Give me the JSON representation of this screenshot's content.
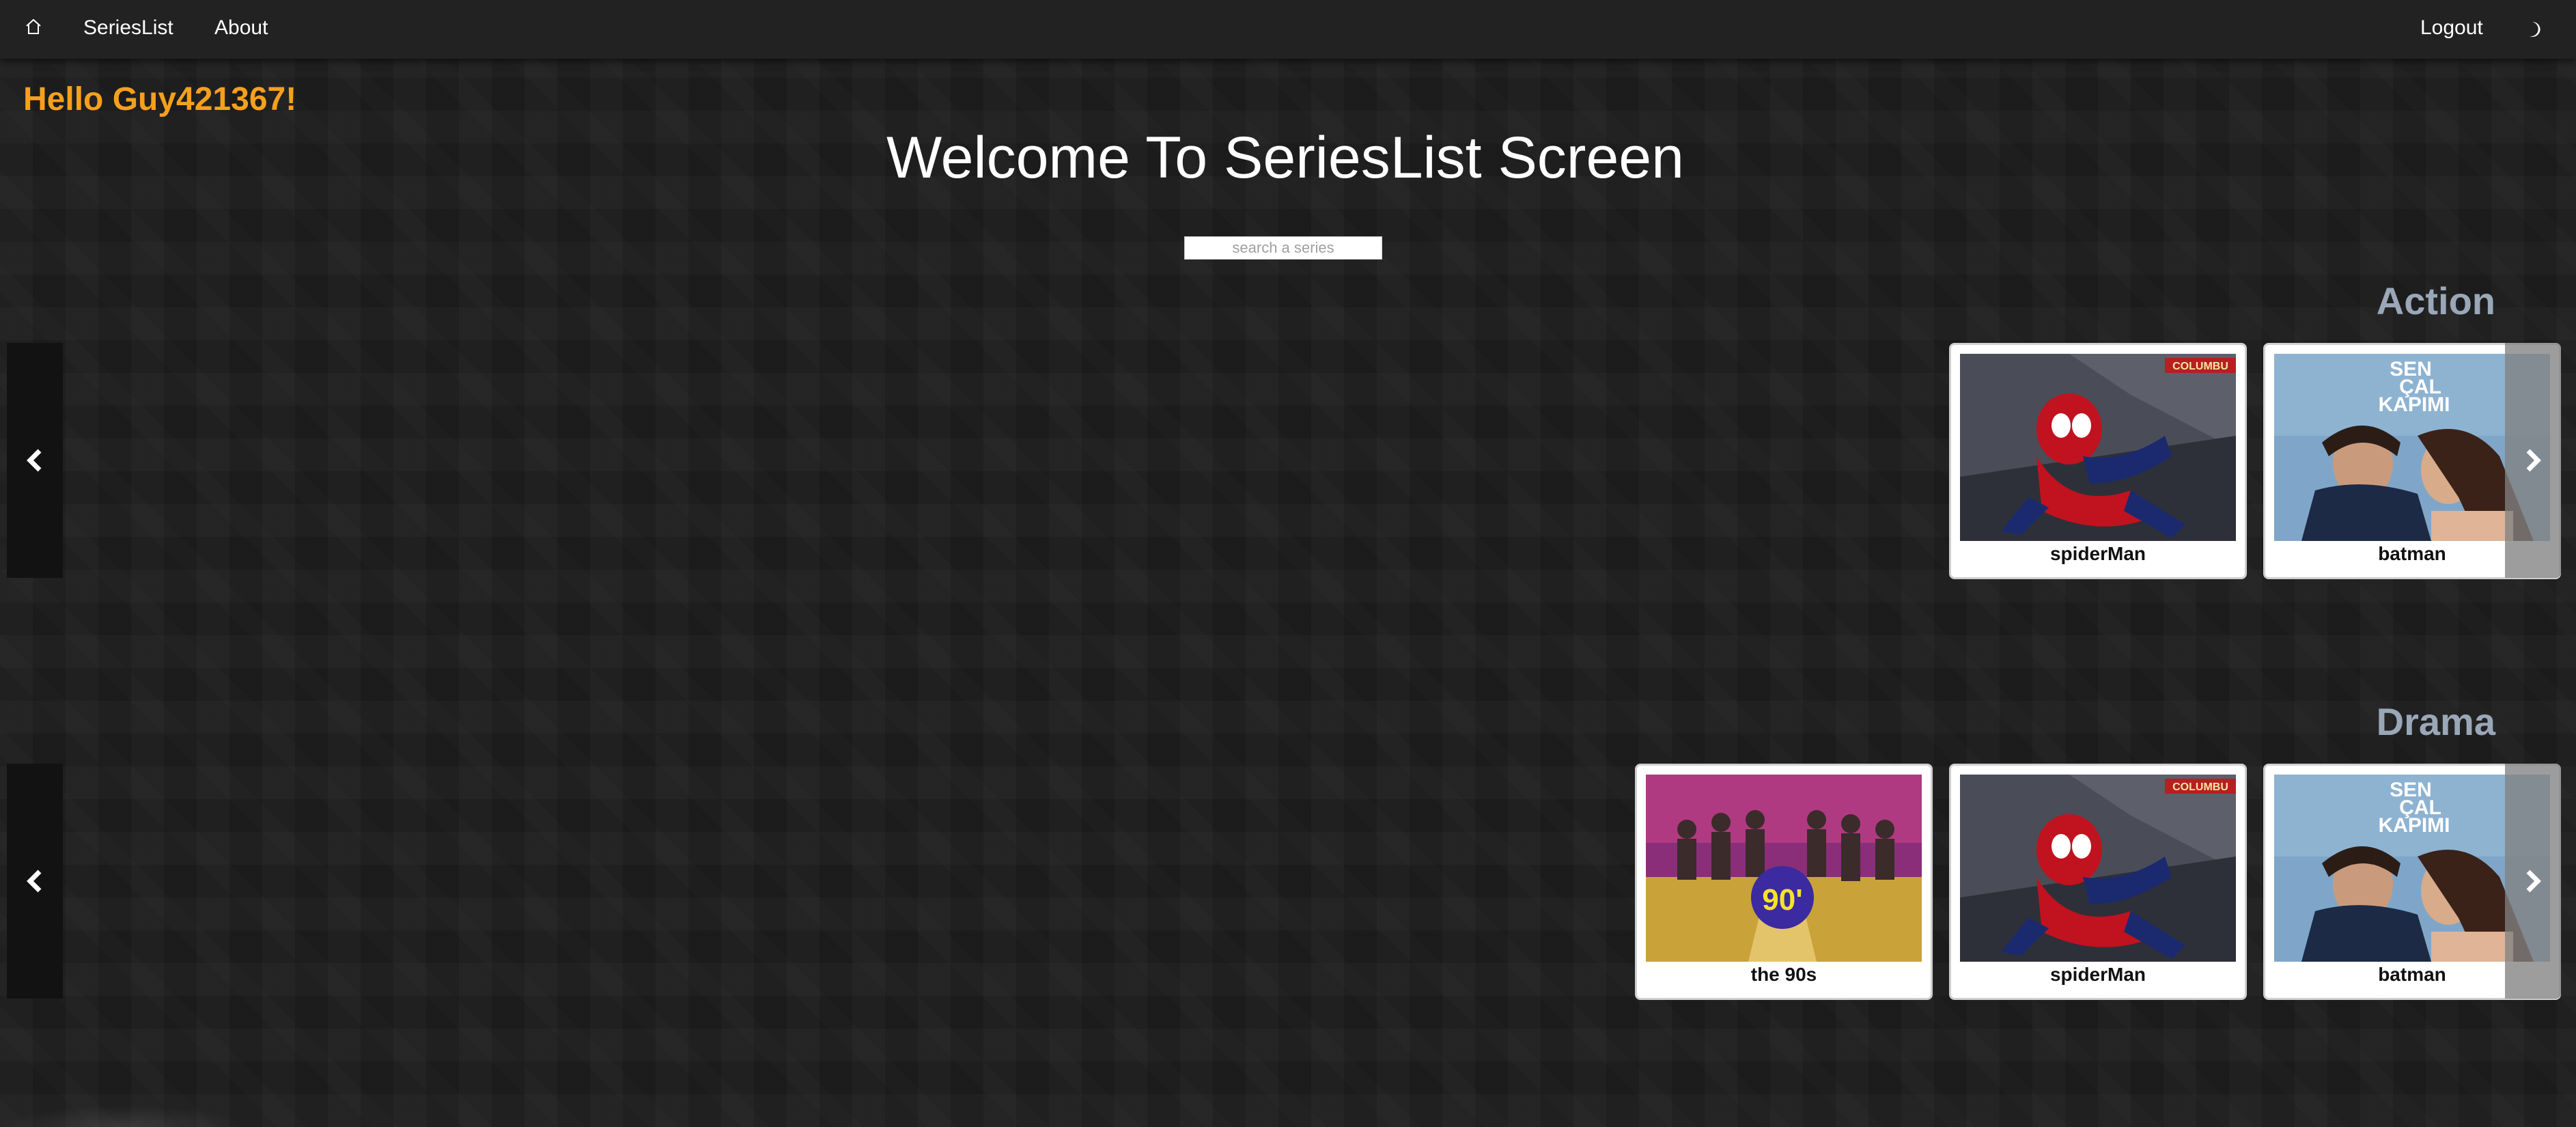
{
  "nav": {
    "home_icon": "home-icon",
    "serieslist_label": "SeriesList",
    "about_label": "About",
    "logout_label": "Logout",
    "theme_icon": "moon-icon"
  },
  "greeting": "Hello Guy421367!",
  "page_title": "Welcome To SeriesList Screen",
  "search": {
    "placeholder": "search a series",
    "value": ""
  },
  "sections": {
    "action": {
      "title": "Action",
      "cards": [
        {
          "name": "spiderMan",
          "poster": "spiderman-poster"
        },
        {
          "name": "batman",
          "poster": "sen-cal-kapimi-poster"
        }
      ]
    },
    "drama": {
      "title": "Drama",
      "cards": [
        {
          "name": "the 90s",
          "poster": "the-90s-poster"
        },
        {
          "name": "spiderMan",
          "poster": "spiderman-poster"
        },
        {
          "name": "batman",
          "poster": "sen-cal-kapimi-poster"
        }
      ]
    }
  },
  "poster_texts": {
    "sen_cal_kapimi_line1": "SEN",
    "sen_cal_kapimi_line2": "ÇAL",
    "sen_cal_kapimi_line3": "KAPIMI",
    "the_90s_logo": "90'"
  },
  "colors": {
    "background": "#1d1d1d",
    "navbar": "#222222",
    "greeting": "#f5a01c",
    "section_title": "#9aa7b8"
  }
}
